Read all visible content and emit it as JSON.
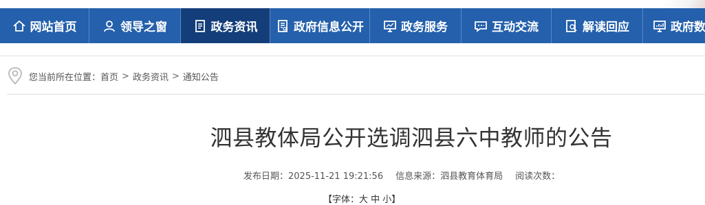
{
  "nav": {
    "items": [
      {
        "label": "网站首页",
        "icon": "home-icon"
      },
      {
        "label": "领导之窗",
        "icon": "person-icon"
      },
      {
        "label": "政务资讯",
        "icon": "document-icon"
      },
      {
        "label": "政府信息公开",
        "icon": "list-document-icon"
      },
      {
        "label": "政务服务",
        "icon": "monitor-icon"
      },
      {
        "label": "互动交流",
        "icon": "chat-icon"
      },
      {
        "label": "解读回应",
        "icon": "search-document-icon"
      },
      {
        "label": "政府数",
        "icon": "chart-monitor-icon"
      }
    ],
    "active_index": 2,
    "bg_color": "#2460ac",
    "active_color": "#133e79"
  },
  "breadcrumb": {
    "prefix": "您当前所在位置：",
    "items": [
      "首页",
      "政务资讯",
      "通知公告"
    ],
    "separator": ">"
  },
  "article": {
    "title": "泗县教体局公开选调泗县六中教师的公告",
    "publish_label": "发布日期：",
    "publish_date": "2025-11-21 19:21:56",
    "source_label": "信息来源：",
    "source": "泗县教育体育局",
    "views_label": "阅读次数：",
    "font_size_control": "【字体：大 中 小】"
  }
}
